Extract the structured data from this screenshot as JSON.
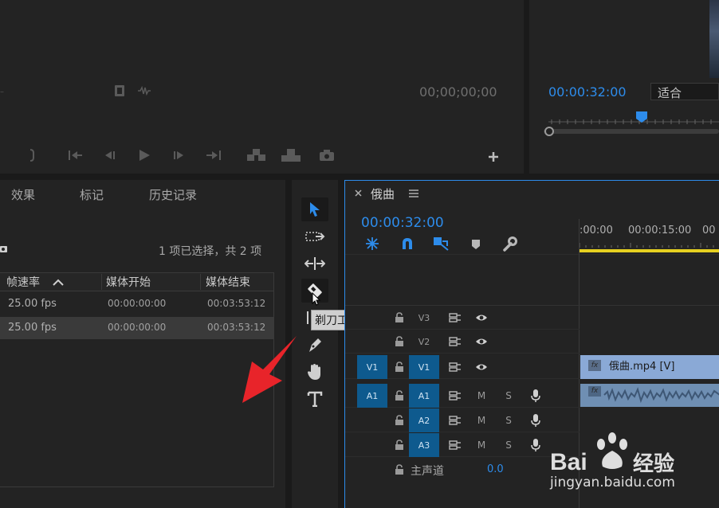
{
  "source_monitor": {
    "timecode": "00;00;00;00"
  },
  "program_monitor": {
    "timecode": "00:00:32:00",
    "fit_label": "适合"
  },
  "project_panel": {
    "tabs": [
      "效果",
      "标记",
      "历史记录"
    ],
    "selection_status": "1 项已选择，共 2 项",
    "columns": [
      "帧速率",
      "媒体开始",
      "媒体结束"
    ],
    "rows": [
      {
        "fps": "25.00 fps",
        "start": "00:00:00:00",
        "end": "00:03:53:12"
      },
      {
        "fps": "25.00 fps",
        "start": "00:00:00:00",
        "end": "00:03:53:12"
      }
    ]
  },
  "tools": {
    "tooltip": "剃刀工具 (C)"
  },
  "timeline": {
    "sequence_name": "俄曲",
    "timecode": "00:00:32:00",
    "ruler": [
      ":00:00",
      "00:00:15:00",
      "00"
    ],
    "tracks_video": [
      {
        "label": "V3"
      },
      {
        "label": "V2"
      },
      {
        "label": "V1",
        "source": "V1"
      }
    ],
    "tracks_audio": [
      {
        "label": "A1",
        "source": "A1"
      },
      {
        "label": "A2"
      },
      {
        "label": "A3"
      }
    ],
    "mute_label": "M",
    "solo_label": "S",
    "master_label": "主声道",
    "master_value": "0.0",
    "video_clip": "俄曲.mp4 [V]",
    "fx_label": "fx"
  },
  "watermark": {
    "brand": "Bai",
    "brand_tail": "经验",
    "url": "jingyan.baidu.com"
  },
  "colors": {
    "accent": "#2d8ceb",
    "video_clip": "#8aa9d6",
    "audio_clip": "#6f8fb3",
    "arrow": "#e8242a",
    "track_target": "#0e5a8e"
  }
}
